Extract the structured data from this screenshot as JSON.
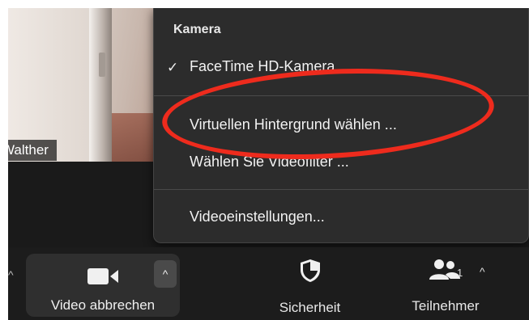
{
  "video": {
    "participant_name": "Walther"
  },
  "menu": {
    "header": "Kamera",
    "check_mark": "✓",
    "items": [
      {
        "label": "FaceTime HD-Kamera"
      },
      {
        "label": "Virtuellen Hintergrund wählen ..."
      },
      {
        "label": "Wählen Sie Videofilter ..."
      },
      {
        "label": "Videoeinstellungen..."
      }
    ]
  },
  "toolbar": {
    "video_label": "Video abbrechen",
    "video_caret": "^",
    "security_label": "Sicherheit",
    "participants_label": "Teilnehmer",
    "participants_count": "1",
    "participants_caret": "^",
    "left_caret": "^"
  },
  "colors": {
    "highlight_ellipse": "#ee2b1d",
    "menu_bg": "#2c2c2c",
    "toolbar_bg": "#1c1c1c"
  }
}
